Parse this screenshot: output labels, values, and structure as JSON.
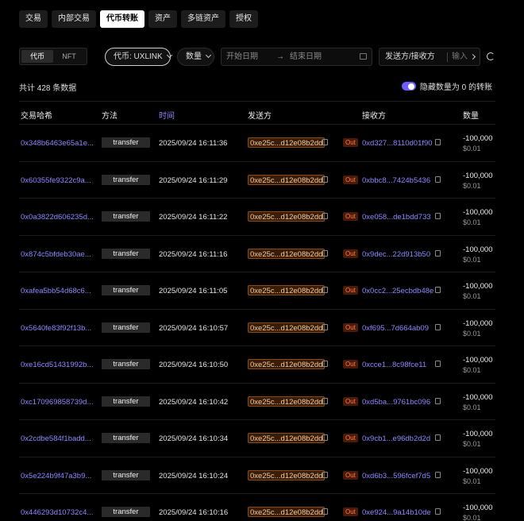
{
  "tabs": [
    {
      "label": "交易",
      "active": false
    },
    {
      "label": "内部交易",
      "active": false
    },
    {
      "label": "代币转账",
      "active": true
    },
    {
      "label": "资产",
      "active": false
    },
    {
      "label": "多链资产",
      "active": false
    },
    {
      "label": "授权",
      "active": false
    }
  ],
  "filters": {
    "segment": {
      "token": "代币",
      "nft": "NFT"
    },
    "token_select": "代币: UXLINK",
    "qty_select": "数量",
    "date_start_placeholder": "开始日期",
    "date_arrow": "→",
    "date_end_placeholder": "结束日期",
    "direction_select": "发送方/接收方",
    "direction_input_placeholder": "输入"
  },
  "summary": {
    "total": "共计 428 条数据",
    "hide_zero_label": "隐藏数量为 0 的转账",
    "hide_zero_on": true
  },
  "table": {
    "headers": {
      "hash": "交易哈希",
      "method": "方法",
      "time": "时间",
      "from": "发送方",
      "to": "接收方",
      "amount": "数量"
    },
    "rows": [
      {
        "hash": "0x348b6463e65a1e...",
        "method": "transfer",
        "time": "2025/09/24 16:11:36",
        "from": "0xe25c...d12e08b2dd",
        "dir": "Out",
        "to": "0xd327...8110d01f90",
        "amount": "-100,000",
        "usd": "$0.01"
      },
      {
        "hash": "0x60355fe9322c9a...",
        "method": "transfer",
        "time": "2025/09/24 16:11:29",
        "from": "0xe25c...d12e08b2dd",
        "dir": "Out",
        "to": "0xbbc8...7424b5436",
        "amount": "-100,000",
        "usd": "$0.01"
      },
      {
        "hash": "0x0a3822d606235d...",
        "method": "transfer",
        "time": "2025/09/24 16:11:22",
        "from": "0xe25c...d12e08b2dd",
        "dir": "Out",
        "to": "0xe058...de1bdd733",
        "amount": "-100,000",
        "usd": "$0.01"
      },
      {
        "hash": "0x874c5bfdeb30ae...",
        "method": "transfer",
        "time": "2025/09/24 16:11:16",
        "from": "0xe25c...d12e08b2dd",
        "dir": "Out",
        "to": "0x9dec...22d913b50",
        "amount": "-100,000",
        "usd": "$0.01"
      },
      {
        "hash": "0xafea5bb54d68c6...",
        "method": "transfer",
        "time": "2025/09/24 16:11:05",
        "from": "0xe25c...d12e08b2dd",
        "dir": "Out",
        "to": "0x0cc2...25ecbdb48e",
        "amount": "-100,000",
        "usd": "$0.01"
      },
      {
        "hash": "0x5640fe83f92f13b...",
        "method": "transfer",
        "time": "2025/09/24 16:10:57",
        "from": "0xe25c...d12e08b2dd",
        "dir": "Out",
        "to": "0xf695...7d664ab09",
        "amount": "-100,000",
        "usd": "$0.01"
      },
      {
        "hash": "0xe16cd51431992b...",
        "method": "transfer",
        "time": "2025/09/24 16:10:50",
        "from": "0xe25c...d12e08b2dd",
        "dir": "Out",
        "to": "0xcce1...8c98fce11",
        "amount": "-100,000",
        "usd": "$0.01"
      },
      {
        "hash": "0xc170969858739d...",
        "method": "transfer",
        "time": "2025/09/24 16:10:42",
        "from": "0xe25c...d12e08b2dd",
        "dir": "Out",
        "to": "0xd5ba...9761bc096",
        "amount": "-100,000",
        "usd": "$0.01"
      },
      {
        "hash": "0x2cdbe584f1badd...",
        "method": "transfer",
        "time": "2025/09/24 16:10:34",
        "from": "0xe25c...d12e08b2dd",
        "dir": "Out",
        "to": "0x9cb1...e96db2d2d",
        "amount": "-100,000",
        "usd": "$0.01"
      },
      {
        "hash": "0x5e224b9f47a3b9...",
        "method": "transfer",
        "time": "2025/09/24 16:10:24",
        "from": "0xe25c...d12e08b2dd",
        "dir": "Out",
        "to": "0xd6b3...596fcef7d5",
        "amount": "-100,000",
        "usd": "$0.01"
      },
      {
        "hash": "0x446293d10732c4...",
        "method": "transfer",
        "time": "2025/09/24 16:10:16",
        "from": "0xe25c...d12e08b2dd",
        "dir": "Out",
        "to": "0xe924...9a14b10de",
        "amount": "-100,000",
        "usd": "$0.01"
      }
    ]
  },
  "colors": {
    "accent": "#8f86ff",
    "toggle": "#6d5dfc",
    "out_badge": "#ff7a3d",
    "from_highlight": "#8a4b12"
  }
}
